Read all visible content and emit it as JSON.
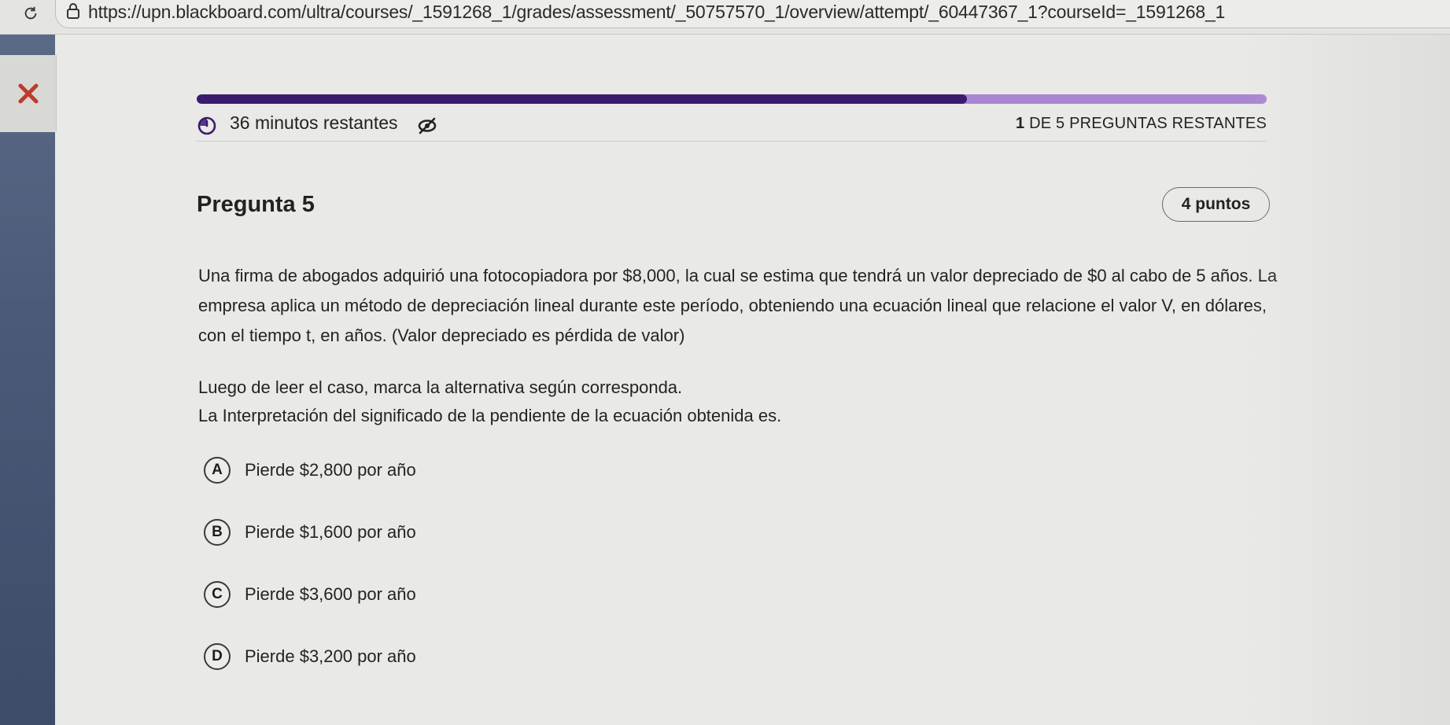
{
  "browser": {
    "url": "https://upn.blackboard.com/ultra/courses/_1591268_1/grades/assessment/_50757570_1/overview/attempt/_60447367_1?courseId=_1591268_1"
  },
  "assessment": {
    "progress_fraction": 0.72,
    "timer_text": "36 minutos restantes",
    "remaining_count": "1",
    "remaining_text": " DE 5 PREGUNTAS RESTANTES"
  },
  "question": {
    "title": "Pregunta 5",
    "points": "4 puntos",
    "body": "Una firma de abogados adquirió una fotocopiadora por $8,000, la cual se estima que tendrá un valor depreciado de $0 al cabo de 5 años. La empresa aplica un método de depreciación lineal durante este período, obteniendo una ecuación lineal que relacione el valor V, en dólares, con el tiempo t, en años. (Valor depreciado es pérdida de valor)",
    "instruction_1": "Luego de leer el caso, marca la alternativa según corresponda.",
    "instruction_2": "La Interpretación del significado de la pendiente de la ecuación obtenida es.",
    "options": [
      {
        "letter": "A",
        "text": "Pierde $2,800 por año"
      },
      {
        "letter": "B",
        "text": "Pierde $1,600 por año"
      },
      {
        "letter": "C",
        "text": "Pierde $3,600 por año"
      },
      {
        "letter": "D",
        "text": "Pierde $3,200 por año"
      }
    ]
  },
  "colors": {
    "progress_fill": "#3b1b6e",
    "progress_track": "#a886d1",
    "close_icon": "#c0392b"
  },
  "icons": {
    "reload": "reload-icon",
    "lock": "lock-icon",
    "close": "close-icon",
    "timer": "timer-icon",
    "hide_timer": "eye-off-icon"
  }
}
